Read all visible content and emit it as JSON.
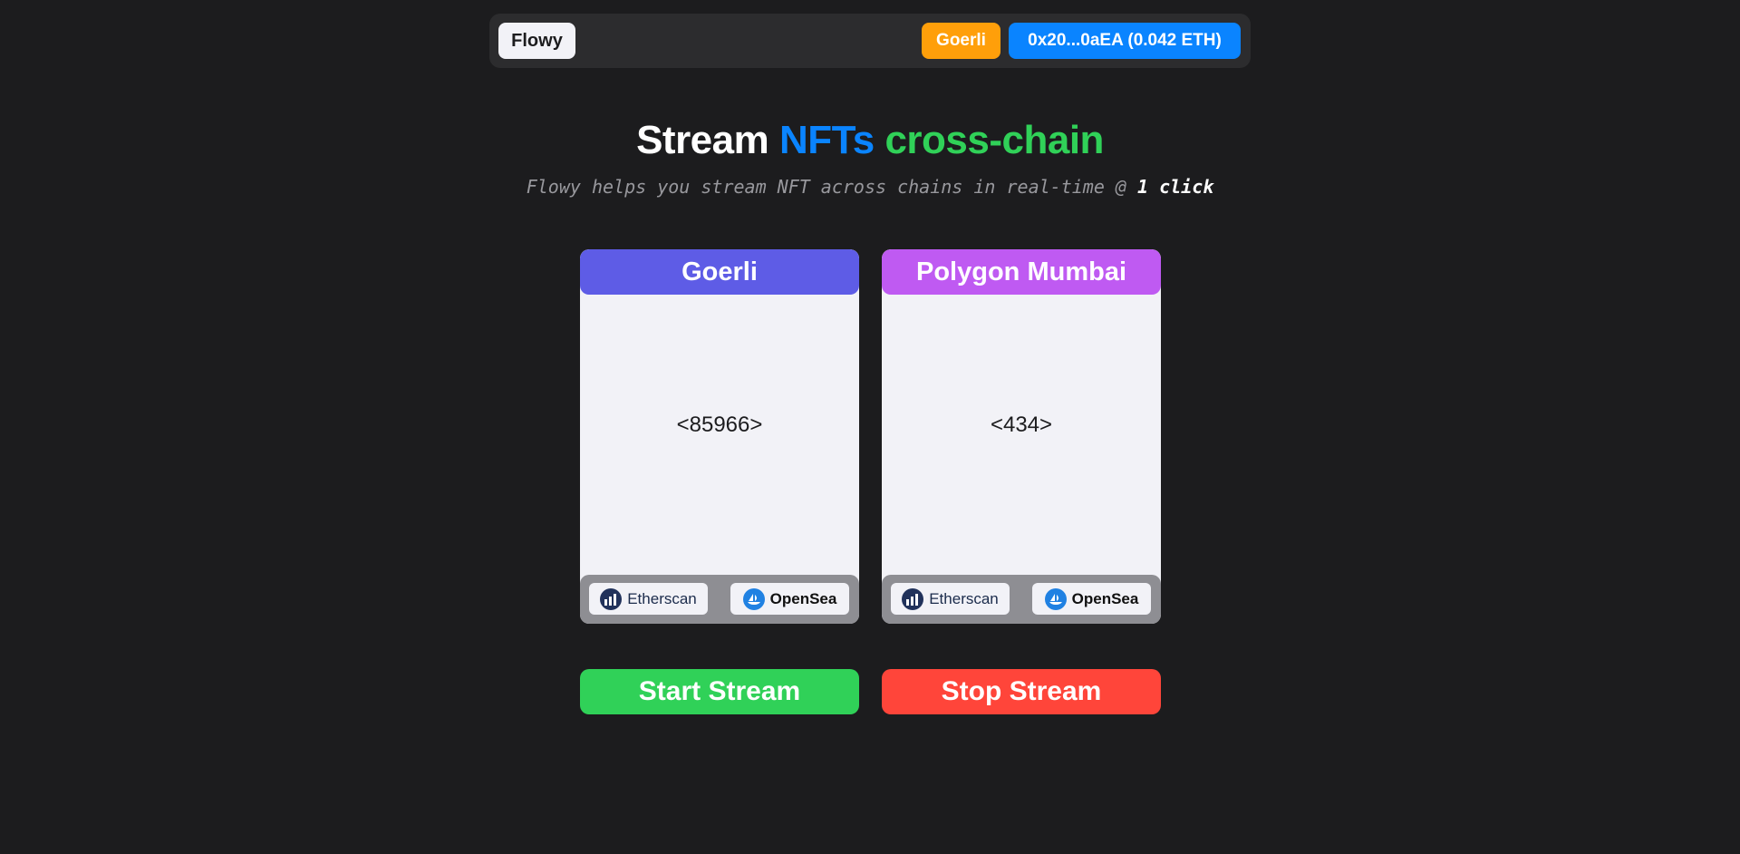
{
  "navbar": {
    "brand_label": "Flowy",
    "network_label": "Goerli",
    "account_label": "0x20...0aEA (0.042 ETH)"
  },
  "hero": {
    "title_part1": "Stream ",
    "title_part2": "NFTs",
    "title_part3": " cross-chain",
    "tagline_main": "Flowy helps you stream NFT across chains in real-time @ ",
    "tagline_emphasis": "1 click"
  },
  "cards": [
    {
      "chain": "Goerli",
      "token_id": "<85966>",
      "links": {
        "explorer": "Etherscan",
        "market": "OpenSea"
      }
    },
    {
      "chain": "Polygon Mumbai",
      "token_id": "<434>",
      "links": {
        "explorer": "Etherscan",
        "market": "OpenSea"
      }
    }
  ],
  "actions": {
    "start_label": "Start Stream",
    "stop_label": "Stop Stream"
  },
  "colors": {
    "background": "#1c1c1e",
    "navbar": "#2c2c2e",
    "network": "#ff9f0a",
    "account": "#0a84ff",
    "goerli_header": "#5e5ce6",
    "mumbai_header": "#bf5af2",
    "start": "#30d158",
    "stop": "#ff453a"
  },
  "icons": {
    "etherscan": "etherscan-icon",
    "opensea": "opensea-icon"
  }
}
